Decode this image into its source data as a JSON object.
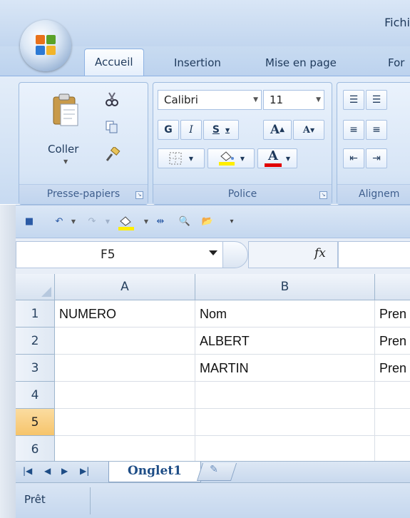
{
  "window": {
    "title": "Fichi"
  },
  "tabs": [
    "Accueil",
    "Insertion",
    "Mise en page",
    "For"
  ],
  "clipboard": {
    "paste_label": "Coller",
    "group_label": "Presse-papiers"
  },
  "font": {
    "name": "Calibri",
    "size": "11",
    "bold": "G",
    "italic": "I",
    "underline": "S",
    "grow": "A",
    "shrink": "A",
    "color_letter": "A",
    "group_label": "Police",
    "fill_color": "#ffee00",
    "font_color": "#e00000"
  },
  "alignment": {
    "group_label": "Alignem"
  },
  "formula_bar": {
    "name_box": "F5",
    "fx": "fx"
  },
  "columns": [
    "A",
    "B"
  ],
  "rows": [
    {
      "num": "1",
      "a": "NUMERO",
      "b": "Nom",
      "c": "Pren"
    },
    {
      "num": "2",
      "a": "",
      "b": "ALBERT",
      "c": "Pren"
    },
    {
      "num": "3",
      "a": "",
      "b": "MARTIN",
      "c": "Pren"
    },
    {
      "num": "4",
      "a": "",
      "b": "",
      "c": ""
    },
    {
      "num": "5",
      "a": "",
      "b": "",
      "c": ""
    },
    {
      "num": "6",
      "a": "",
      "b": "",
      "c": ""
    }
  ],
  "sheets": {
    "active": "Onglet1"
  },
  "status": {
    "text": "Prêt"
  }
}
